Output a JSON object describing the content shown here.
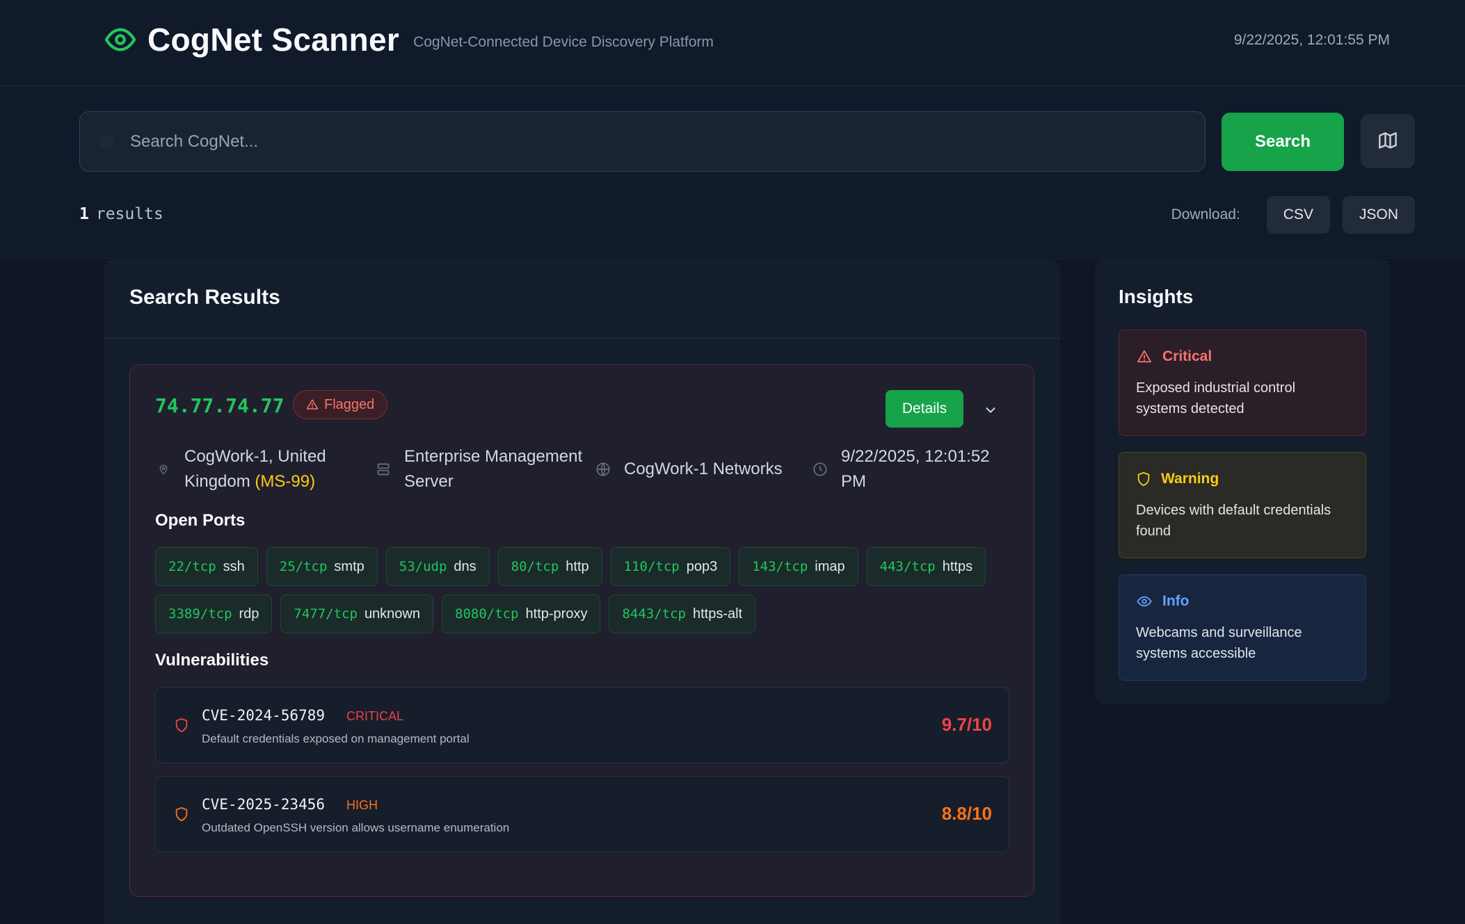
{
  "app": {
    "title": "CogNet Scanner",
    "subtitle": "CogNet-Connected Device Discovery Platform",
    "timestamp": "9/22/2025, 12:01:55 PM",
    "brand_color": "#22c55e"
  },
  "search": {
    "placeholder": "Search CogNet...",
    "value": "",
    "button_label": "Search",
    "map_icon": "map-icon"
  },
  "results": {
    "count": "1",
    "label": "results",
    "download_label": "Download:",
    "csv_label": "CSV",
    "json_label": "JSON",
    "panel_title": "Search Results"
  },
  "device": {
    "ip": "74.77.74.77",
    "flag_label": "Flagged",
    "details_label": "Details",
    "location_line1": "CogWork-1, United",
    "location_line2": "Kingdom",
    "location_code": "(MS-99)",
    "type_line1": "Enterprise Management",
    "type_line2": "Server",
    "network": "CogWork-1 Networks",
    "seen_line1": "9/22/2025, 12:01:52",
    "seen_line2": "PM",
    "open_ports_title": "Open Ports",
    "ports": [
      {
        "port": "22/tcp",
        "service": "ssh"
      },
      {
        "port": "25/tcp",
        "service": "smtp"
      },
      {
        "port": "53/udp",
        "service": "dns"
      },
      {
        "port": "80/tcp",
        "service": "http"
      },
      {
        "port": "110/tcp",
        "service": "pop3"
      },
      {
        "port": "143/tcp",
        "service": "imap"
      },
      {
        "port": "443/tcp",
        "service": "https"
      },
      {
        "port": "3389/tcp",
        "service": "rdp"
      },
      {
        "port": "7477/tcp",
        "service": "unknown"
      },
      {
        "port": "8080/tcp",
        "service": "http-proxy"
      },
      {
        "port": "8443/tcp",
        "service": "https-alt"
      }
    ],
    "vulnerabilities_title": "Vulnerabilities",
    "vulnerabilities": [
      {
        "id": "CVE-2024-56789",
        "severity": "CRITICAL",
        "description": "Default credentials exposed on management portal",
        "score": "9.7/10",
        "color": "#ef4444"
      },
      {
        "id": "CVE-2025-23456",
        "severity": "HIGH",
        "description": "Outdated OpenSSH version allows username enumeration",
        "score": "8.8/10",
        "color": "#f97316"
      }
    ]
  },
  "insights": {
    "title": "Insights",
    "items": [
      {
        "level": "Critical",
        "text_line1": "Exposed industrial control",
        "text_line2": "systems detected",
        "color": "#f87171",
        "icon": "alert-triangle-icon"
      },
      {
        "level": "Warning",
        "text_line1": "Devices with default credentials",
        "text_line2": "found",
        "color": "#facc15",
        "icon": "shield-icon"
      },
      {
        "level": "Info",
        "text_line1": "Webcams and surveillance",
        "text_line2": "systems accessible",
        "color": "#60a5fa",
        "icon": "eye-icon"
      }
    ]
  }
}
